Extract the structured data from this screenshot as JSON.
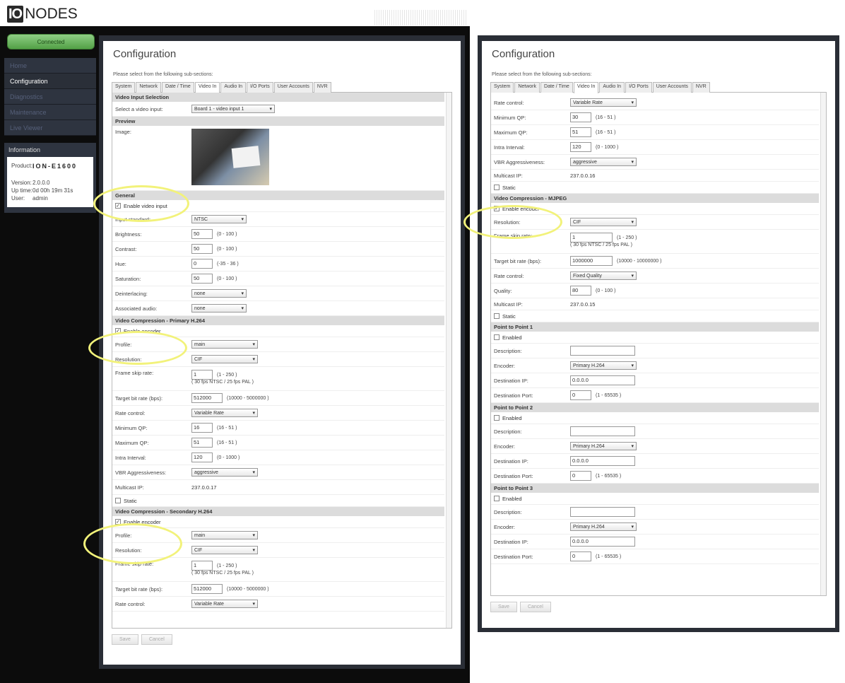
{
  "brand": {
    "box": "IO",
    "name": "NODES"
  },
  "sidebar": {
    "status": "Connected",
    "nav": [
      "Home",
      "Configuration",
      "Diagnostics",
      "Maintenance",
      "Live Viewer"
    ],
    "info_title": "Information",
    "product_label": "Product:",
    "product_value": "ION-E1600",
    "version_label": "Version:",
    "version_value": "2.0.0.0",
    "uptime_label": "Up time:",
    "uptime_value": "0d 00h 19m 31s",
    "user_label": "User:",
    "user_value": "admin"
  },
  "panel": {
    "title": "Configuration",
    "subtitle": "Please select from the following sub-sections:",
    "tabs": [
      "System",
      "Network",
      "Date / Time",
      "Video In",
      "Audio In",
      "I/O Ports",
      "User Accounts",
      "NVR"
    ],
    "save": "Save",
    "cancel": "Cancel"
  },
  "left": {
    "s_input": "Video Input Selection",
    "select_input_label": "Select a video input:",
    "select_input_value": "Board 1 - video input 1",
    "s_preview": "Preview",
    "image_label": "Image:",
    "s_general": "General",
    "enable_video_input": "Enable video input",
    "input_standard_label": "Input standard:",
    "input_standard_value": "NTSC",
    "brightness_label": "Brightness:",
    "brightness_value": "50",
    "brightness_range": "(0 - 100 )",
    "contrast_label": "Contrast:",
    "contrast_value": "50",
    "contrast_range": "(0 - 100 )",
    "hue_label": "Hue:",
    "hue_value": "0",
    "hue_range": "(-35 - 36 )",
    "saturation_label": "Saturation:",
    "saturation_value": "50",
    "saturation_range": "(0 - 100 )",
    "deinterlacing_label": "Deinterlacing:",
    "deinterlacing_value": "none",
    "assoc_audio_label": "Associated audio:",
    "assoc_audio_value": "none",
    "s_primary": "Video Compression - Primary H.264",
    "enable_encoder": "Enable encoder",
    "profile_label": "Profile:",
    "profile_value": "main",
    "resolution_label": "Resolution:",
    "resolution_value": "CIF",
    "frame_skip_label": "Frame skip rate:",
    "frame_skip_value": "1",
    "frame_skip_range": "(1 - 250 )",
    "fps_hint": "( 30 fps NTSC / 25 fps PAL )",
    "target_bitrate_label": "Target bit rate (bps):",
    "target_bitrate_value": "512000",
    "target_bitrate_range": "(10000 - 5000000 )",
    "rate_control_label": "Rate control:",
    "rate_control_value": "Variable Rate",
    "min_qp_label": "Minimum QP:",
    "min_qp_value": "16",
    "min_qp_range": "(16 - 51 )",
    "max_qp_label": "Maximum QP:",
    "max_qp_value": "51",
    "max_qp_range": "(16 - 51 )",
    "intra_label": "Intra Interval:",
    "intra_value": "120",
    "intra_range": "(0 - 1000 )",
    "vbr_label": "VBR Aggressiveness:",
    "vbr_value": "aggressive",
    "multicast_label": "Multicast IP:",
    "multicast_value": "237.0.0.17",
    "static_label": "Static",
    "s_secondary": "Video Compression - Secondary H.264",
    "sec_profile_value": "main",
    "sec_resolution_value": "CIF",
    "sec_frame_skip_value": "1",
    "sec_target_bitrate_value": "512000",
    "sec_rate_control_value": "Variable Rate"
  },
  "right": {
    "rate_control_value": "Variable Rate",
    "min_qp_value": "30",
    "max_qp_value": "51",
    "intra_value": "120",
    "vbr_value": "aggressive",
    "multicast_value": "237.0.0.16",
    "s_mjpeg": "Video Compression - MJPEG",
    "resolution_value": "CIF",
    "frame_skip_value": "1",
    "target_bitrate_value": "1000000",
    "target_bitrate_range": "(10000 - 10000000 )",
    "rate_control2_value": "Fixed Quality",
    "quality_label": "Quality:",
    "quality_value": "80",
    "quality_range": "(0 - 100 )",
    "multicast2_value": "237.0.0.15",
    "s_p2p1": "Point to Point 1",
    "s_p2p2": "Point to Point 2",
    "s_p2p3": "Point to Point 3",
    "enabled_label": "Enabled",
    "description_label": "Description:",
    "encoder_label": "Encoder:",
    "encoder_value": "Primary H.264",
    "dest_ip_label": "Destination IP:",
    "dest_ip_value": "0.0.0.0",
    "dest_port_label": "Destination Port:",
    "dest_port_value": "0",
    "dest_port_range": "(1 - 65535 )"
  }
}
